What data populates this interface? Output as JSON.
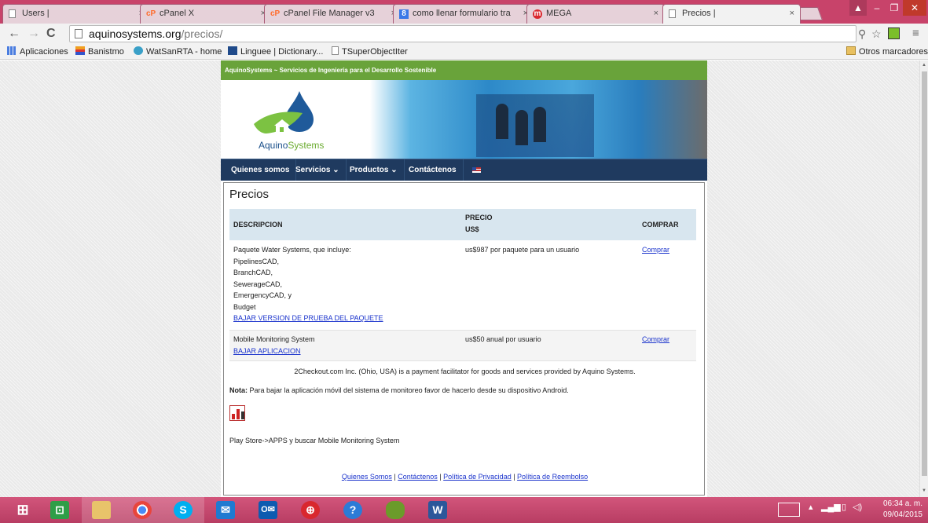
{
  "browser": {
    "tabs": [
      {
        "title": "Users |",
        "favicon": "page-icon",
        "active": false
      },
      {
        "title": "cPanel X",
        "favicon": "cpanel-icon",
        "active": false
      },
      {
        "title": "cPanel File Manager v3",
        "favicon": "cpanel-icon",
        "active": false
      },
      {
        "title": "como llenar formulario tra",
        "favicon": "google-icon",
        "active": false
      },
      {
        "title": "MEGA",
        "favicon": "mega-icon",
        "active": false
      },
      {
        "title": "Precios |",
        "favicon": "page-icon",
        "active": true
      }
    ],
    "tab_close_glyph": "×",
    "url_host": "aquinosystems.org",
    "url_path": "/precios/",
    "bookmarks": [
      {
        "label": "Aplicaciones",
        "icon": "apps-grid-icon"
      },
      {
        "label": "Banistmo",
        "icon": "banistmo-icon"
      },
      {
        "label": "WatSanRTA - home",
        "icon": "watsan-icon"
      },
      {
        "label": "Linguee | Dictionary...",
        "icon": "linguee-icon"
      },
      {
        "label": "TSuperObjectIter",
        "icon": "page-icon"
      }
    ],
    "other_bookmarks": "Otros marcadores"
  },
  "site": {
    "topbar_text": "AquinoSystems ~ Servicios de Ingeniería para el Desarrollo Sostenible",
    "logo_text_a": "Aquino",
    "logo_text_b": "Systems",
    "nav": [
      {
        "label": "Quienes somos"
      },
      {
        "label": "Servicios ⌄"
      },
      {
        "label": "Productos ⌄"
      },
      {
        "label": "Contáctenos"
      }
    ],
    "page_title": "Precios",
    "table": {
      "headers": {
        "description": "DESCRIPCION",
        "price_line1": "PRECIO",
        "price_line2": "US$",
        "buy": "COMPRAR"
      },
      "rows": [
        {
          "description_lines": [
            "Paquete Water Systems, que incluye:",
            "PipelinesCAD,",
            "BranchCAD,",
            "SewerageCAD,",
            "EmergencyCAD, y",
            "Budget"
          ],
          "download_link": "BAJAR VERSION DE PRUEBA DEL PAQUETE",
          "price": "us$987 por paquete para un usuario",
          "buy": "Comprar"
        },
        {
          "description_lines": [
            "Mobile Monitoring System"
          ],
          "download_link": "BAJAR APLICACION",
          "price": "us$50 anual por usuario",
          "buy": "Comprar"
        }
      ]
    },
    "facilitator_text": "2Checkout.com Inc. (Ohio, USA) is a payment facilitator for goods and services provided by Aquino Systems.",
    "note_label": "Nota:",
    "note_text": " Para bajar la aplicación móvil del sistema de monitoreo favor de hacerlo desde su dispositivo Android.",
    "playstore_text": "Play Store->APPS y buscar Mobile Monitoring System",
    "footer_links": [
      "Quienes Somos",
      "Contáctenos",
      "Política de Privacidad",
      "Política de Reembolso"
    ],
    "footer_separator": " | "
  },
  "taskbar": {
    "apps": [
      "windows-start-icon",
      "store-icon",
      "file-explorer-icon",
      "chrome-icon",
      "skype-icon",
      "mail-icon",
      "outlook-icon",
      "opera-icon",
      "help-icon",
      "game-icon",
      "word-icon"
    ],
    "time": "06:34 a. m.",
    "date": "09/04/2015"
  },
  "colors": {
    "titlebar": "#c8436a",
    "site_green": "#69a33a",
    "nav_blue": "#1f3a5f",
    "table_header": "#d8e6ef",
    "link": "#1a33cc"
  }
}
